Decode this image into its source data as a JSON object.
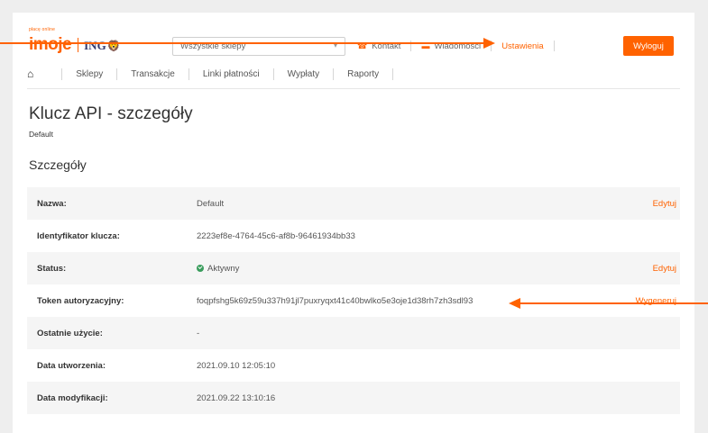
{
  "header": {
    "logo_small": "płacę online",
    "logo_main": "imoje",
    "logo_bank": "ING",
    "shop_select": "Wszystkie sklepy",
    "contact": "Kontakt",
    "messages": "Wiadomości",
    "settings": "Ustawienia",
    "logout": "Wyloguj"
  },
  "nav": {
    "items": [
      "Sklepy",
      "Transakcje",
      "Linki płatności",
      "Wypłaty",
      "Raporty"
    ]
  },
  "page": {
    "title": "Klucz API - szczegóły",
    "subtitle": "Default",
    "section": "Szczegóły"
  },
  "details": {
    "rows": [
      {
        "label": "Nazwa:",
        "value": "Default",
        "action": "Edytuj"
      },
      {
        "label": "Identyfikator klucza:",
        "value": "2223ef8e-4764-45c6-af8b-96461934bb33"
      },
      {
        "label": "Status:",
        "value": "Aktywny",
        "action": "Edytuj"
      },
      {
        "label": "Token autoryzacyjny:",
        "value": "foqpfshg5k69z59u337h91jl7puxryqxt41c40bwlko5e3oje1d38rh7zh3sdl93",
        "action": "Wygeneruj"
      },
      {
        "label": "Ostatnie użycie:",
        "value": "-"
      },
      {
        "label": "Data utworzenia:",
        "value": "2021.09.10 12:05:10"
      },
      {
        "label": "Data modyfikacji:",
        "value": "2021.09.22 13:10:16"
      }
    ]
  },
  "colors": {
    "accent": "#ff6200",
    "status_active": "#3a9d5d"
  },
  "icons": {
    "home": "home-icon",
    "phone": "phone-icon",
    "message": "message-icon",
    "caret": "chevron-down-icon",
    "status": "check-circle-icon"
  }
}
